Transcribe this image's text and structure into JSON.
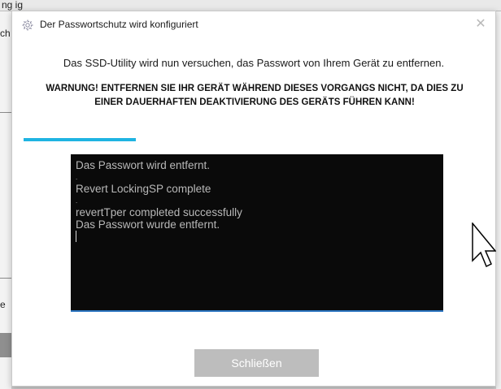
{
  "background": {
    "top_fragment": "ng ig",
    "left_fragment_1": "ch",
    "left_fragment_2": "e"
  },
  "dialog": {
    "title": "Der Passwortschutz wird konfiguriert",
    "title_icon": "gear-icon",
    "close_icon": "close-icon",
    "info": "Das SSD-Utility wird nun versuchen, das Passwort von Ihrem Gerät zu entfernen.",
    "warning": "WARNUNG! ENTFERNEN SIE IHR GERÄT WÄHREND DIESES VORGANGS NICHT, DA DIES ZU EINER DAUERHAFTEN DEAKTIVIERUNG DES GERÄTS FÜHREN KANN!",
    "progress_fraction": 0.48,
    "accent_color": "#1fb4e2",
    "console": {
      "lines": [
        "Das Passwort wird entfernt.",
        ".",
        "Revert LockingSP complete",
        ".",
        "revertTper completed successfully",
        "Das Passwort wurde entfernt."
      ]
    },
    "close_button_label": "Schließen"
  },
  "cursor_icon": "mouse-pointer-icon"
}
